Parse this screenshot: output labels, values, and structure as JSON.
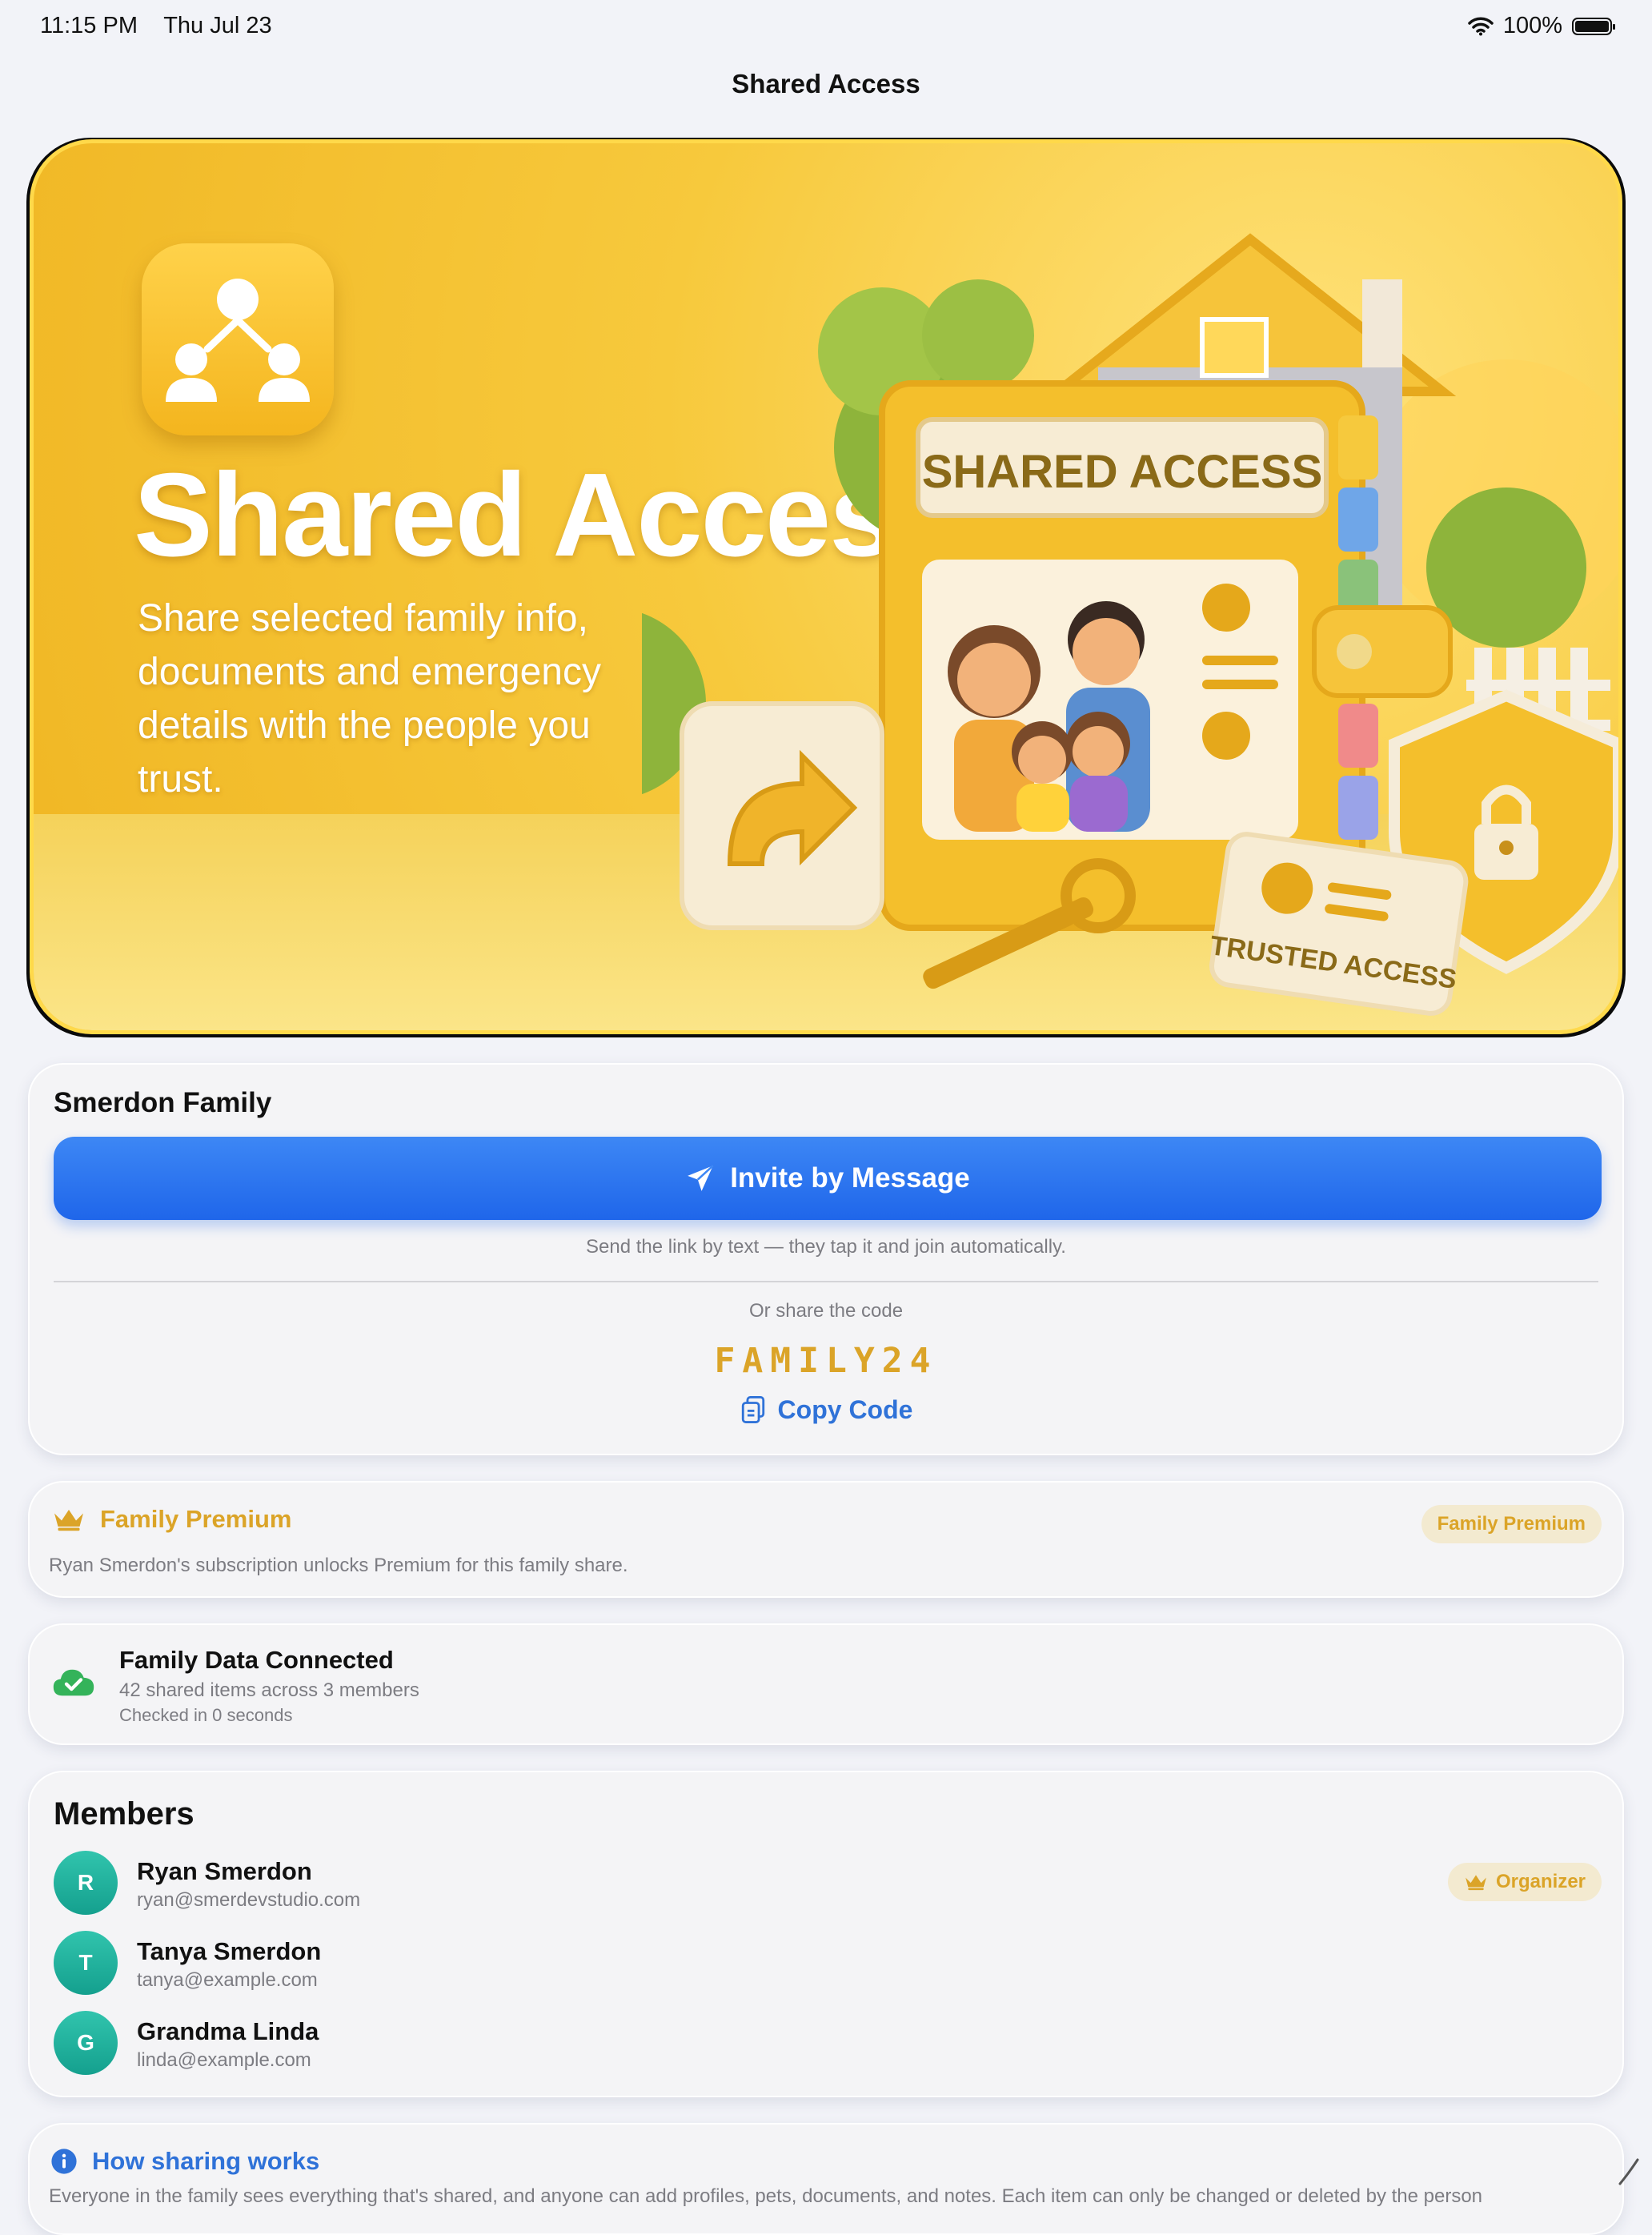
{
  "status_bar": {
    "time": "11:15 PM",
    "date": "Thu Jul 23",
    "battery": "100%"
  },
  "nav": {
    "title": "Shared Access"
  },
  "hero": {
    "title": "Shared Access",
    "subtitle": "Share selected family info, documents and emergency details with the people you trust.",
    "folder_label": "SHARED ACCESS",
    "card_label": "TRUSTED ACCESS"
  },
  "invite": {
    "family_name": "Smerdon Family",
    "button_label": "Invite by Message",
    "hint": "Send the link by text — they tap it and join automatically.",
    "code_label": "Or share the code",
    "code": "FAMILY24",
    "copy_label": "Copy Code"
  },
  "premium": {
    "title": "Family Premium",
    "badge": "Family Premium",
    "description": "Ryan Smerdon's subscription unlocks Premium for this family share."
  },
  "sync": {
    "title": "Family Data Connected",
    "subtitle": "42 shared items across 3 members",
    "checked": "Checked in 0 seconds"
  },
  "members": {
    "title": "Members",
    "list": [
      {
        "initial": "R",
        "name": "Ryan Smerdon",
        "email": "ryan@smerdevstudio.com",
        "role": "Organizer"
      },
      {
        "initial": "T",
        "name": "Tanya Smerdon",
        "email": "tanya@example.com"
      },
      {
        "initial": "G",
        "name": "Grandma Linda",
        "email": "linda@example.com"
      }
    ]
  },
  "how": {
    "title": "How sharing works",
    "description": "Everyone in the family sees everything that's shared, and anyone can add profiles, pets, documents, and notes. Each item can only be changed or deleted by the person"
  },
  "colors": {
    "accent_blue": "#2a74ef",
    "link_blue": "#2f72d8",
    "gold": "#dba428",
    "gold_badge_bg": "#f3ead0",
    "teal_avatar": "#1aa893",
    "green_check": "#34b35a"
  },
  "icons": {
    "wifi": "wifi-icon",
    "battery": "battery-icon",
    "send": "paper-plane-icon",
    "copy": "copy-icon",
    "crown": "crown-icon",
    "cloud_check": "cloud-check-icon",
    "info": "info-icon"
  }
}
